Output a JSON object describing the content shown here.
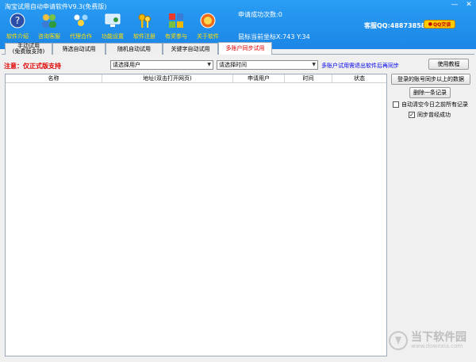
{
  "window": {
    "title": "淘宝试用自动申请软件V9.3(免费版)",
    "min": "—",
    "close": "✕"
  },
  "toolbar": [
    {
      "label": "软件介绍",
      "icon": "question-icon"
    },
    {
      "label": "咨询客服",
      "icon": "people-icon"
    },
    {
      "label": "代理合作",
      "icon": "partner-icon"
    },
    {
      "label": "功能设置",
      "icon": "monitor-icon"
    },
    {
      "label": "软件注册",
      "icon": "keys-icon"
    },
    {
      "label": "有奖参与",
      "icon": "apps-icon"
    },
    {
      "label": "关于软件",
      "icon": "about-icon"
    }
  ],
  "status": {
    "success_count": "申请成功次数:0",
    "cursor": "鼠标当前坐标X:743 Y:34"
  },
  "support": {
    "qq": "客服QQ:488738580",
    "qq_button": "QQ交谈"
  },
  "tabs": [
    {
      "label_line1": "手动试用",
      "label_line2": "(免费版支持)"
    },
    {
      "label_line1": "筛选自动试用"
    },
    {
      "label_line1": "随机自动试用"
    },
    {
      "label_line1": "关键字自动试用"
    },
    {
      "label_line1": "多账户同步试用"
    }
  ],
  "main": {
    "notice": "注意：仅正式版支持",
    "user_select": "请选择用户",
    "time_select": "请选择时间",
    "hint": "多账户试用需退出软件后再同步",
    "tutorial_button": "使用教程",
    "columns": [
      "名称",
      "地址(双击打开网页)",
      "申请用户",
      "时间",
      "状态"
    ],
    "sync_button": "登录的账号同步以上的数据",
    "delete_button": "删除一条记录",
    "clear_check": {
      "label": "自动清空今日之前所有记录",
      "checked": false
    },
    "sync_check": {
      "label": "同步曾经成功",
      "checked": true
    }
  },
  "watermark": {
    "text": "当下软件园",
    "sub": "www.downxia.com"
  },
  "colors": {
    "titlebar": "#1b86e6",
    "toolbar_label": "#ffe000",
    "notice": "#e00000",
    "hint": "#0000ee"
  }
}
